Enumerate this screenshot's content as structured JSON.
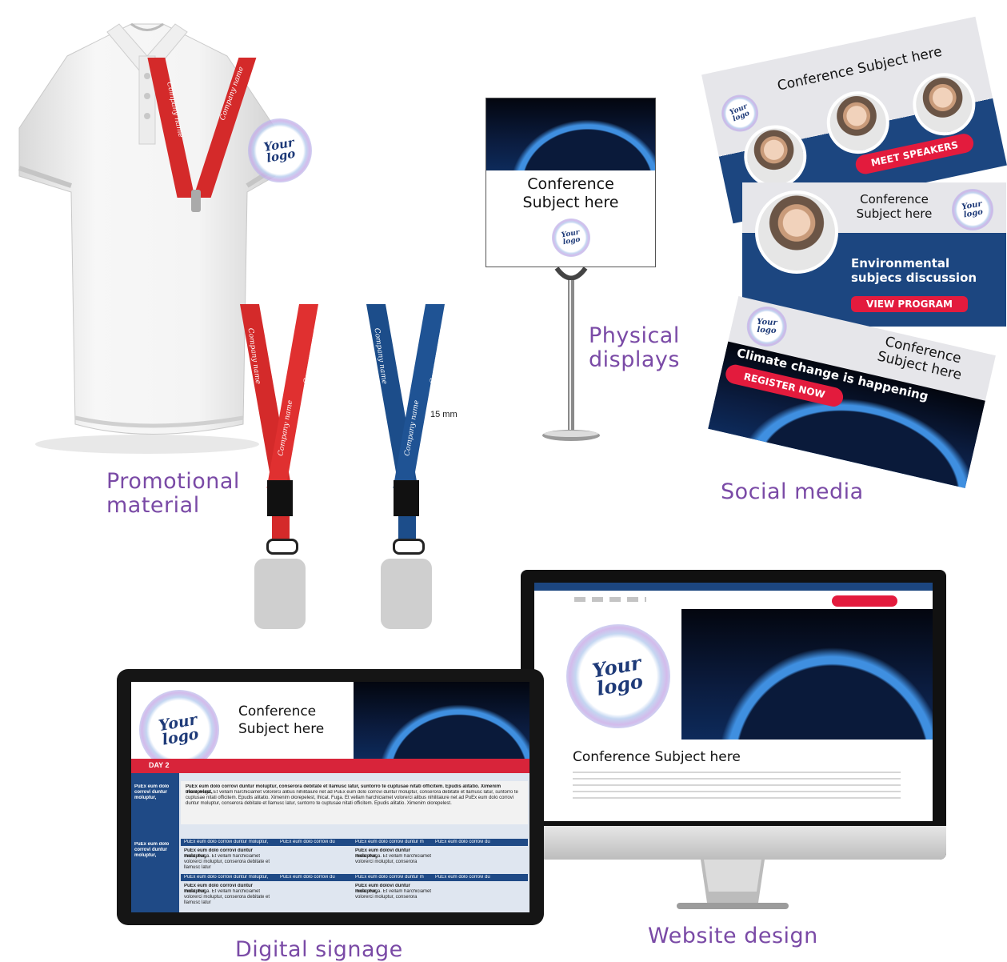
{
  "captions": {
    "promotional": "Promotional material",
    "physical": "Physical displays",
    "social": "Social media",
    "signage": "Digital signage",
    "website": "Website design"
  },
  "logo": {
    "line1": "Your",
    "line2": "logo"
  },
  "lanyard": {
    "text": "Company name",
    "dimension": "15 mm"
  },
  "display_stand": {
    "title_line1": "Conference",
    "title_line2": "Subject here"
  },
  "social_cards": {
    "card1": {
      "title": "Conference Subject here",
      "button": "MEET SPEAKERS"
    },
    "card2": {
      "title_line1": "Conference",
      "title_line2": "Subject here",
      "topic_line1": "Environmental",
      "topic_line2": "subjecs discussion",
      "button": "VIEW PROGRAM"
    },
    "card3": {
      "title_line1": "Conference",
      "title_line2": "Subject here",
      "headline": "Climate change is happening",
      "button": "REGISTER NOW"
    }
  },
  "signage": {
    "title_line1": "Conference",
    "title_line2": "Subject here",
    "day_label": "DAY 2",
    "row_label": "PuEx eum dolo corrovi duntur moluptur,",
    "intro_bold": "PuEx eum dolo corrovi duntur moluptur, conserora debitate et llamusc latur, suntorro te cuptusae nitati officitem. Epudis alitatio. Ximenim olorepelest,",
    "intro_text": "Ihicat. Fuga. Et vellam harchiciamet volorerci alibus nihilitaiure net ad PuEx eum dolo corrovi duntur moluptur, conserora debitate et llamusc latur, suntorro te cuptusae nitati officitem. Epudis alitatio. Ximenim olorepelest, Ihicat. Fuga. Et vellam harchiciamet volorerci alibus nihilitaiure net ad PuEx eum dolo corrovi duntur moluptur, conserora debitate et llamusc latur, suntorro te cuptusae nitati officitem. Epudis alitatio. Ximenim olorepelest.",
    "col_headers": [
      "PuEx eum dolo corrovi duntur moluptur,",
      "PuEx eum dolo corrovi du",
      "PuEx eum dolo corrovi duntur m",
      "PuEx eum dolo corrovi du"
    ],
    "cell_bold": "PuEx eum dolo corrovi duntur moluptur,",
    "cell_text": "Ihicat. Fuga. Et vellam harchiciamet volorerci moluptur, conserora debitate et llamusc latur",
    "cell_bold_short": "PuEx eum dolovi duntur moluptur,",
    "cell_text_short": "Ihicat. Fuga. Et vellam harchiciamet volorerci moluptur, conserora"
  },
  "website": {
    "title": "Conference Subject here"
  },
  "colors": {
    "navy": "#1c4680",
    "red": "#e31b3d",
    "lanyard_red": "#d42a2a",
    "lanyard_blue": "#1c4d8a",
    "caption": "#7a4aa6"
  }
}
